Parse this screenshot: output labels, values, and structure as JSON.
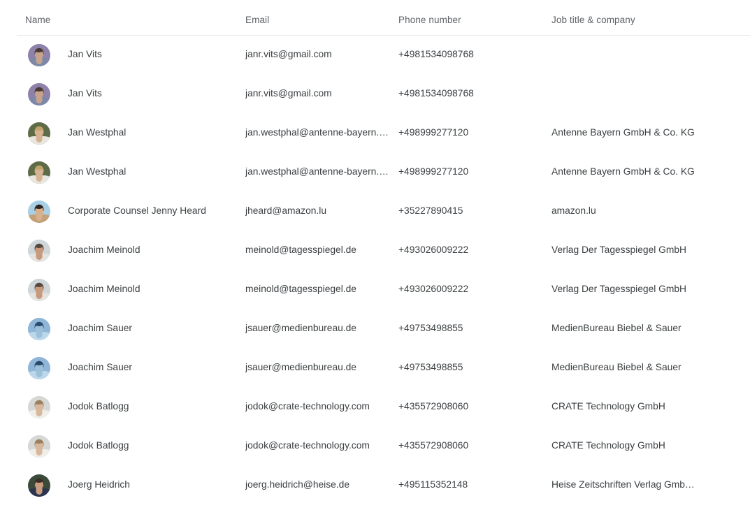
{
  "table": {
    "columns": [
      {
        "key": "name",
        "label": "Name"
      },
      {
        "key": "email",
        "label": "Email"
      },
      {
        "key": "phone",
        "label": "Phone number"
      },
      {
        "key": "job",
        "label": "Job title & company"
      }
    ],
    "rows": [
      {
        "avatar": "avatar-photo-jan-vits",
        "name": "Jan Vits",
        "email": "janr.vits@gmail.com",
        "phone": "+4981534098768",
        "job": ""
      },
      {
        "avatar": "avatar-photo-jan-vits",
        "name": "Jan Vits",
        "email": "janr.vits@gmail.com",
        "phone": "+4981534098768",
        "job": ""
      },
      {
        "avatar": "avatar-photo-jan-westphal",
        "name": "Jan Westphal",
        "email": "jan.westphal@antenne-bayern.…",
        "phone": "+498999277120",
        "job": "Antenne Bayern GmbH & Co. KG"
      },
      {
        "avatar": "avatar-photo-jan-westphal",
        "name": "Jan Westphal",
        "email": "jan.westphal@antenne-bayern.…",
        "phone": "+498999277120",
        "job": "Antenne Bayern GmbH & Co. KG"
      },
      {
        "avatar": "avatar-photo-jenny-heard",
        "name": "Corporate Counsel Jenny Heard",
        "email": "jheard@amazon.lu",
        "phone": "+35227890415",
        "job": "amazon.lu"
      },
      {
        "avatar": "avatar-photo-joachim-meinold",
        "name": "Joachim Meinold",
        "email": "meinold@tagesspiegel.de",
        "phone": "+493026009222",
        "job": "Verlag Der Tagesspiegel GmbH"
      },
      {
        "avatar": "avatar-photo-joachim-meinold",
        "name": "Joachim Meinold",
        "email": "meinold@tagesspiegel.de",
        "phone": "+493026009222",
        "job": "Verlag Der Tagesspiegel GmbH"
      },
      {
        "avatar": "avatar-photo-joachim-sauer",
        "name": "Joachim Sauer",
        "email": "jsauer@medienbureau.de",
        "phone": "+49753498855",
        "job": "MedienBureau Biebel & Sauer"
      },
      {
        "avatar": "avatar-photo-joachim-sauer",
        "name": "Joachim Sauer",
        "email": "jsauer@medienbureau.de",
        "phone": "+49753498855",
        "job": "MedienBureau Biebel & Sauer"
      },
      {
        "avatar": "avatar-photo-jodok-batlogg",
        "name": "Jodok Batlogg",
        "email": "jodok@crate-technology.com",
        "phone": "+435572908060",
        "job": "CRATE Technology GmbH"
      },
      {
        "avatar": "avatar-photo-jodok-batlogg",
        "name": "Jodok Batlogg",
        "email": "jodok@crate-technology.com",
        "phone": "+435572908060",
        "job": "CRATE Technology GmbH"
      },
      {
        "avatar": "avatar-photo-joerg-heidrich",
        "name": "Joerg Heidrich",
        "email": "joerg.heidrich@heise.de",
        "phone": "+495115352148",
        "job": "Heise Zeitschriften Verlag Gmb…"
      }
    ]
  },
  "colors": {
    "header_text": "#5f6368",
    "body_text": "#3c4043",
    "divider": "#e6e7e8",
    "background": "#ffffff"
  },
  "avatar_palettes": {
    "avatar-photo-jan-vits": {
      "bg": "#8e82ab",
      "skin": "#c6a48c",
      "hair": "#4a3a33",
      "shirt": "#7d87a8"
    },
    "avatar-photo-jan-westphal": {
      "bg": "#5e6b47",
      "skin": "#d7b394",
      "hair": "#bfa36a",
      "shirt": "#e8e6de"
    },
    "avatar-photo-jenny-heard": {
      "bg": "#a9cfe4",
      "skin": "#d9b08c",
      "hair": "#2d2422",
      "shirt": "#c4a177"
    },
    "avatar-photo-joachim-meinold": {
      "bg": "#cfd6d9",
      "skin": "#c79a7d",
      "hair": "#55483f",
      "shirt": "#e4e3df"
    },
    "avatar-photo-joachim-sauer": {
      "bg": "#8fb6d8",
      "skin": "#9cc0da",
      "hair": "#2b4a6b",
      "shirt": "#bcd7ea"
    },
    "avatar-photo-jodok-batlogg": {
      "bg": "#d5d8d4",
      "skin": "#d8b89c",
      "hair": "#9b7f5e",
      "shirt": "#efeee9"
    },
    "avatar-photo-joerg-heidrich": {
      "bg": "#3c4a3a",
      "skin": "#c99c80",
      "hair": "#3a2f28",
      "shirt": "#2c3550"
    }
  }
}
